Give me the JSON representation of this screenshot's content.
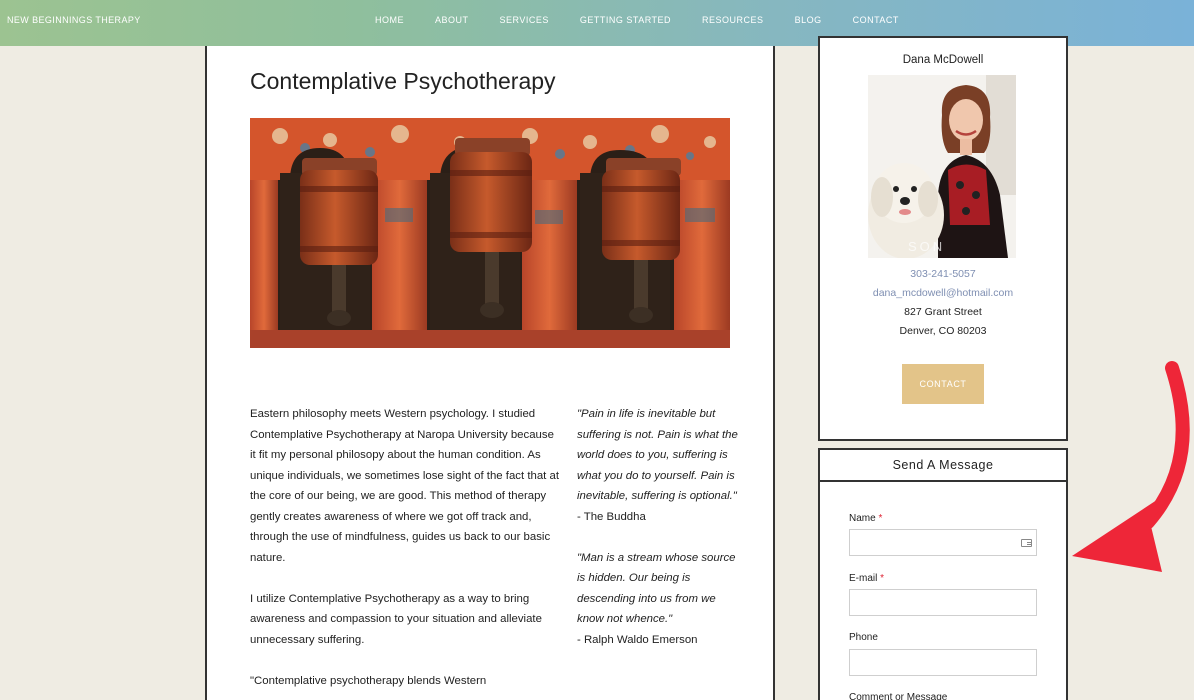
{
  "header": {
    "brand": "NEW BEGINNINGS THERAPY",
    "nav": [
      "HOME",
      "ABOUT",
      "SERVICES",
      "GETTING STARTED",
      "RESOURCES",
      "BLOG",
      "CONTACT"
    ]
  },
  "article": {
    "title": "Contemplative Psychotherapy",
    "paragraphs": [
      "Eastern philosophy meets Western psychology. I studied Contemplative Psychotherapy at Naropa University because it fit my personal philosopy about the human condition. As unique individuals, we sometimes lose sight of the fact that at the core of our being, we are good. This method of therapy gently creates awareness of where we got off track and, through the use of mindfulness, guides us back to our basic nature.",
      "I utilize Contemplative Psychotherapy as a way to bring awareness and compassion to your situation and alleviate unnecessary suffering.",
      "\"Contemplative psychotherapy blends Western"
    ],
    "quotes": [
      {
        "text": "\"Pain in life is inevitable but suffering is not. Pain is what the world does to you, suffering is what you do to yourself. Pain is inevitable, suffering is optional.\"",
        "author": "- The Buddha"
      },
      {
        "text": "\"Man is a stream whose source is hidden. Our being is descending into us from we know not whence.\"",
        "author": "- Ralph Waldo Emerson"
      }
    ]
  },
  "profile": {
    "name": "Dana McDowell",
    "phone": "303-241-5057",
    "email": "dana_mcdowell@hotmail.com",
    "address1": "827 Grant Street",
    "address2": "Denver, CO 80203",
    "contact_label": "CONTACT"
  },
  "message_form": {
    "heading": "Send A Message",
    "name_label": "Name",
    "email_label": "E-mail",
    "phone_label": "Phone",
    "comment_label": "Comment or Message",
    "required_mark": "*"
  },
  "colors": {
    "accent_button": "#e3c489",
    "link": "#7f8fb2",
    "arrow": "#ee2638"
  }
}
